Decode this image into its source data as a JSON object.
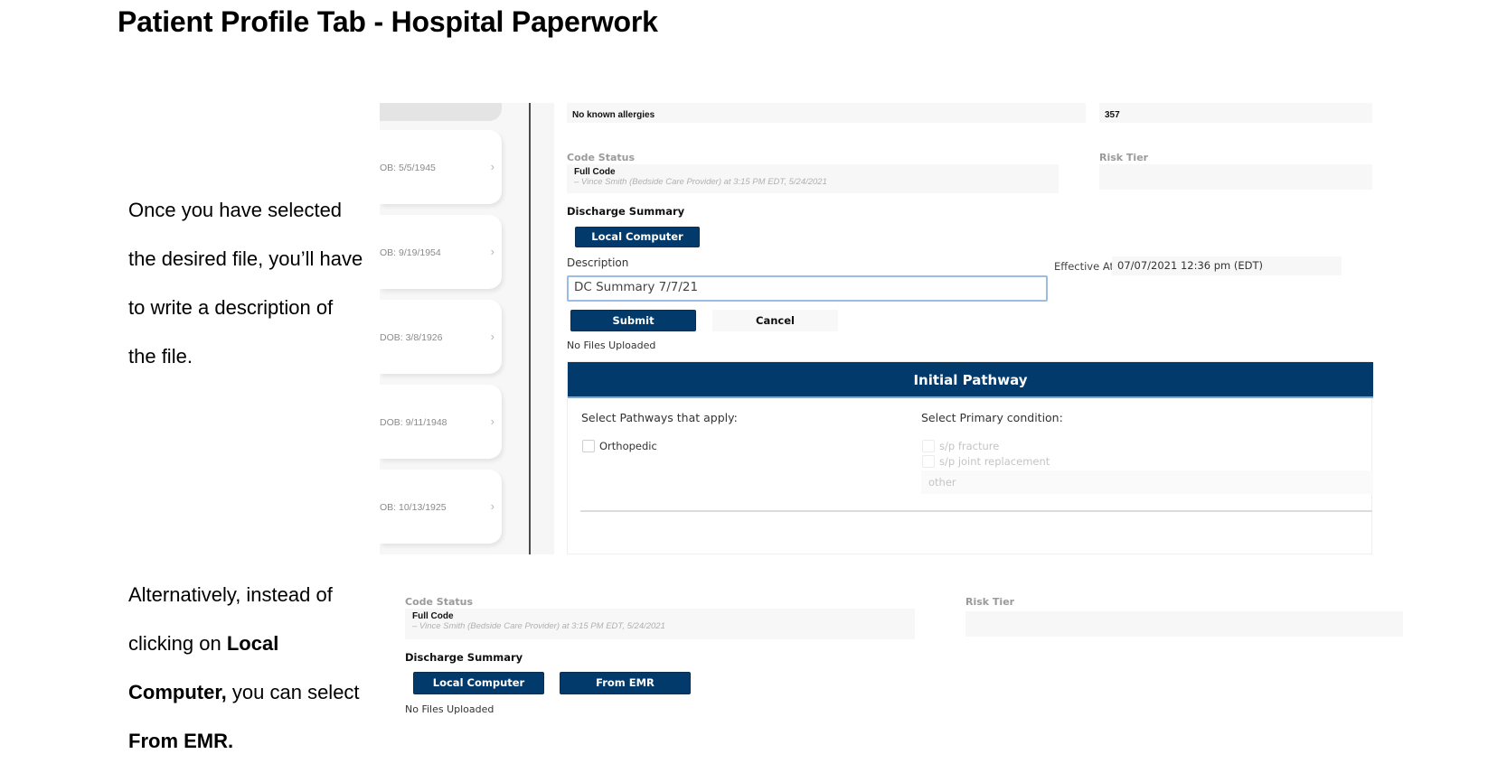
{
  "document": {
    "title": "Patient Profile Tab - Hospital Paperwork",
    "instruction_1": "Once you have selected the desired file, you’ll have to write a description of the file.",
    "instruction_2": {
      "part1": "Alternatively, instead of clicking on ",
      "bold1": "Local Computer,",
      "part2": " you can select ",
      "bold2": "From EMR."
    }
  },
  "screenshot_1": {
    "sidebar": {
      "patients": [
        {
          "dob": "OB: 5/5/1945",
          "chevron_icon": "chevron-right-icon"
        },
        {
          "dob": "OB: 9/19/1954",
          "chevron_icon": "chevron-right-icon"
        },
        {
          "dob": "DOB: 3/8/1926",
          "chevron_icon": "chevron-right-icon"
        },
        {
          "dob": "DOB: 9/11/1948",
          "chevron_icon": "chevron-right-icon"
        },
        {
          "dob": "OB: 10/13/1925",
          "chevron_icon": "chevron-right-icon"
        }
      ]
    },
    "allergies": {
      "value": "No known allergies"
    },
    "top_right_value": "357",
    "code_status": {
      "label": "Code Status",
      "value": "Full Code",
      "attribution": "– Vince Smith (Bedside Care Provider) at 3:15 PM EDT, 5/24/2021"
    },
    "risk_tier": {
      "label": "Risk Tier",
      "value": ""
    },
    "discharge_summary": {
      "label": "Discharge Summary",
      "local_computer_button": "Local Computer",
      "description_label": "Description",
      "description_value": "DC Summary 7/7/21",
      "effective_at_label": "Effective At",
      "effective_at_value": "07/07/2021 12:36 pm (EDT)",
      "submit_button": "Submit",
      "cancel_button": "Cancel",
      "files_status": "No Files Uploaded"
    },
    "initial_pathway": {
      "title": "Initial Pathway",
      "pathways_label": "Select Pathways that apply:",
      "pathways": [
        {
          "label": "Orthopedic",
          "checked": false
        }
      ],
      "condition_label": "Select Primary condition:",
      "conditions": [
        {
          "label": "s/p fracture",
          "checked": false,
          "disabled": true
        },
        {
          "label": "s/p joint replacement",
          "checked": false,
          "disabled": true
        }
      ],
      "other_placeholder": "other"
    }
  },
  "screenshot_2": {
    "code_status": {
      "label": "Code Status",
      "value": "Full Code",
      "attribution": "– Vince Smith (Bedside Care Provider) at 3:15 PM EDT, 5/24/2021"
    },
    "risk_tier": {
      "label": "Risk Tier",
      "value": ""
    },
    "discharge_summary": {
      "label": "Discharge Summary",
      "local_computer_button": "Local Computer",
      "from_emr_button": "From EMR",
      "files_status": "No Files Uploaded"
    }
  },
  "colors": {
    "primary_navy": "#013a6b",
    "field_bg": "#f7f7f7",
    "focus_border": "#9bbde3"
  }
}
